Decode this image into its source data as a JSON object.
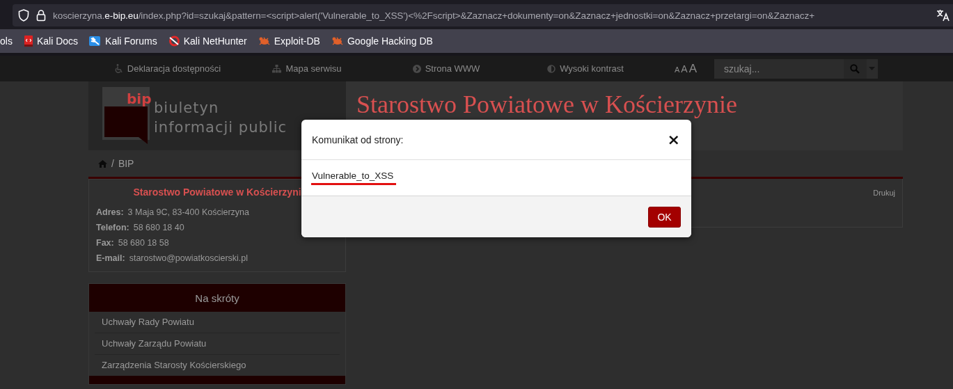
{
  "browser": {
    "url": {
      "subdomain": "koscierzyna.",
      "domain": "e-bip.eu",
      "path": "/index.php?id=szukaj&pattern=<script>alert('Vulnerable_to_XSS')<%2Fscript>&Zaznacz+dokumenty=on&Zaznacz+jednostki=on&Zaznacz+przetargi=on&Zaznacz+"
    },
    "bookmarks": [
      {
        "label": "ols",
        "kind": "plain"
      },
      {
        "label": "Kali Docs",
        "kind": "docs"
      },
      {
        "label": "Kali Forums",
        "kind": "forums"
      },
      {
        "label": "Kali NetHunter",
        "kind": "nethunter"
      },
      {
        "label": "Exploit-DB",
        "kind": "bug"
      },
      {
        "label": "Google Hacking DB",
        "kind": "bug"
      }
    ]
  },
  "top_nav": {
    "links": [
      {
        "label": "Deklaracja dostępności",
        "kind": "accessibility"
      },
      {
        "label": "Mapa serwisu",
        "kind": "sitemap"
      },
      {
        "label": "Strona WWW",
        "kind": "arrow"
      },
      {
        "label": "Wysoki kontrast",
        "kind": "contrast"
      }
    ],
    "font_sizes": [
      "A",
      "A",
      "A"
    ],
    "search": {
      "placeholder": "szukaj..."
    }
  },
  "header": {
    "logo": {
      "mark": "bip",
      "line_1": "biuletyn",
      "line_2": "informacji public"
    },
    "title": "Starostwo Powiatowe w Kościerzynie"
  },
  "breadcrumb": [
    {
      "separator": "/",
      "label": "BIP"
    }
  ],
  "contact": {
    "name": "Starostwo Powiatowe w Kościerzyni",
    "rows": [
      {
        "label": "Adres:",
        "value": "3 Maja 9C, 83-400 Kościerzyna"
      },
      {
        "label": "Telefon:",
        "value": "58 680 18 40"
      },
      {
        "label": "Fax:",
        "value": "58 680 18 58"
      },
      {
        "label": "E-mail:",
        "value": "starostwo@powiatkoscierski.pl"
      }
    ]
  },
  "shortcuts": {
    "title": "Na skróty",
    "items": [
      "Uchwały Rady Powiatu",
      "Uchwały Zarządu Powiatu",
      "Zarządzenia Starosty Kościerskiego"
    ]
  },
  "content": {
    "print_link": "Drukuj"
  },
  "dialog": {
    "title": "Komunikat od strony:",
    "close": "×",
    "message": "Vulnerable_to_XSS",
    "message_underlined": true,
    "button": "OK"
  }
}
